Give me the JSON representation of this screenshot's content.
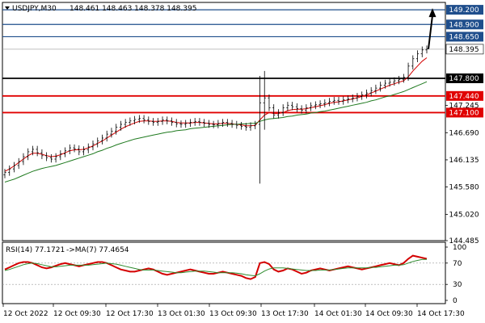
{
  "header": {
    "symbol_label": "USDJPY,M30",
    "ohlc_label": "148.461 148.463 148.378 148.395"
  },
  "rsi_header": {
    "rsi_label": "RSI(14) 77.1721",
    "ma_label": "->MA(7) 77.4654"
  },
  "colors": {
    "candle": "#000000",
    "ma_fast": "#d40000",
    "ma_slow": "#1f7a1f",
    "support": "#e00000",
    "resistance": "#1f4e8c",
    "pivot": "#000000",
    "rsi_line": "#d40000",
    "rsi_ma": "#2e8b2e",
    "arrow": "#000000"
  },
  "chart_data": [
    {
      "type": "candlestick",
      "title": "USDJPY,M30",
      "ylim": [
        144.485,
        149.35
      ],
      "y_ticks": [
        "149.200",
        "148.900",
        "148.650",
        "148.395",
        "147.800",
        "147.440",
        "147.245",
        "147.100",
        "146.690",
        "146.135",
        "145.580",
        "145.020",
        "144.485"
      ],
      "x_ticks": [
        "12 Oct 2022",
        "12 Oct 09:30",
        "12 Oct 17:30",
        "13 Oct 01:30",
        "13 Oct 09:30",
        "13 Oct 17:30",
        "14 Oct 01:30",
        "14 Oct 09:30",
        "14 Oct 17:30"
      ],
      "levels": [
        {
          "value": 149.2,
          "kind": "resistance"
        },
        {
          "value": 148.9,
          "kind": "resistance"
        },
        {
          "value": 148.65,
          "kind": "resistance"
        },
        {
          "value": 147.8,
          "kind": "pivot"
        },
        {
          "value": 147.44,
          "kind": "support"
        },
        {
          "value": 147.1,
          "kind": "support"
        }
      ],
      "current_price": 148.395,
      "arrow": {
        "from": 148.4,
        "to": 149.2
      },
      "series": [
        {
          "kind": "ohlc",
          "close": [
            145.88,
            145.95,
            146.02,
            146.1,
            146.2,
            146.3,
            146.35,
            146.28,
            146.22,
            146.18,
            146.15,
            146.2,
            146.26,
            146.32,
            146.38,
            146.36,
            146.3,
            146.34,
            146.4,
            146.46,
            146.52,
            146.58,
            146.66,
            146.72,
            146.8,
            146.86,
            146.9,
            146.93,
            146.96,
            146.98,
            146.95,
            146.92,
            146.9,
            146.92,
            146.95,
            146.93,
            146.9,
            146.87,
            146.86,
            146.88,
            146.9,
            146.92,
            146.9,
            146.88,
            146.86,
            146.85,
            146.88,
            146.9,
            146.88,
            146.86,
            146.84,
            146.82,
            146.8,
            146.83,
            146.86,
            147.3,
            147.4,
            147.2,
            147.05,
            147.1,
            147.2,
            147.25,
            147.22,
            147.18,
            147.15,
            147.2,
            147.24,
            147.26,
            147.28,
            147.3,
            147.33,
            147.35,
            147.33,
            147.36,
            147.38,
            147.4,
            147.43,
            147.46,
            147.5,
            147.55,
            147.6,
            147.66,
            147.7,
            147.72,
            147.75,
            147.78,
            147.82,
            148.05,
            148.2,
            148.3,
            148.38,
            148.4
          ]
        },
        {
          "name": "",
          "kind": "ma",
          "values": [
            145.9,
            145.95,
            146.01,
            146.08,
            146.15,
            146.22,
            146.27,
            146.27,
            146.25,
            146.22,
            146.2,
            146.21,
            146.24,
            146.28,
            146.32,
            146.34,
            146.34,
            146.35,
            146.38,
            146.42,
            146.47,
            146.52,
            146.58,
            146.64,
            146.7,
            146.76,
            146.81,
            146.85,
            146.89,
            146.92,
            146.93,
            146.93,
            146.92,
            146.92,
            146.93,
            146.93,
            146.92,
            146.9,
            146.89,
            146.89,
            146.89,
            146.9,
            146.9,
            146.89,
            146.88,
            146.87,
            146.87,
            146.88,
            146.88,
            146.87,
            146.86,
            146.85,
            146.83,
            146.83,
            146.84,
            146.95,
            147.05,
            147.1,
            147.08,
            147.08,
            147.1,
            147.14,
            147.16,
            147.17,
            147.17,
            147.18,
            147.2,
            147.22,
            147.24,
            147.26,
            147.29,
            147.31,
            147.32,
            147.34,
            147.36,
            147.38,
            147.4,
            147.43,
            147.46,
            147.5,
            147.54,
            147.58,
            147.62,
            147.66,
            147.69,
            147.72,
            147.75,
            147.83,
            147.95,
            148.05,
            148.15,
            148.22
          ]
        },
        {
          "name": "",
          "kind": "ma",
          "values": [
            145.68,
            145.71,
            145.74,
            145.78,
            145.82,
            145.86,
            145.9,
            145.93,
            145.96,
            145.98,
            146.0,
            146.02,
            146.05,
            146.08,
            146.11,
            146.14,
            146.17,
            146.2,
            146.23,
            146.26,
            146.3,
            146.33,
            146.37,
            146.4,
            146.44,
            146.47,
            146.5,
            146.53,
            146.56,
            146.58,
            146.6,
            146.62,
            146.64,
            146.66,
            146.68,
            146.7,
            146.71,
            146.73,
            146.74,
            146.75,
            146.77,
            146.78,
            146.79,
            146.8,
            146.81,
            146.82,
            146.83,
            146.84,
            146.85,
            146.86,
            146.86,
            146.87,
            146.87,
            146.88,
            146.88,
            146.92,
            146.95,
            146.97,
            146.98,
            146.99,
            147.0,
            147.02,
            147.03,
            147.05,
            147.06,
            147.07,
            147.09,
            147.1,
            147.12,
            147.13,
            147.15,
            147.17,
            147.19,
            147.21,
            147.23,
            147.25,
            147.27,
            147.29,
            147.31,
            147.34,
            147.36,
            147.39,
            147.42,
            147.44,
            147.47,
            147.5,
            147.53,
            147.57,
            147.61,
            147.65,
            147.69,
            147.73
          ]
        }
      ]
    },
    {
      "type": "line",
      "title": "RSI(14) 77.1721",
      "ylim": [
        0,
        100
      ],
      "y_ticks": [
        "100",
        "70",
        "30",
        "0"
      ],
      "series": [
        {
          "name": "RSI(14) 77.1721",
          "values": [
            58,
            62,
            66,
            70,
            72,
            72,
            70,
            66,
            62,
            60,
            62,
            65,
            68,
            70,
            68,
            66,
            64,
            66,
            68,
            70,
            72,
            72,
            70,
            66,
            62,
            58,
            56,
            54,
            54,
            56,
            58,
            60,
            58,
            54,
            50,
            48,
            50,
            52,
            54,
            56,
            58,
            56,
            54,
            52,
            50,
            50,
            52,
            54,
            52,
            50,
            48,
            46,
            42,
            40,
            44,
            70,
            72,
            68,
            58,
            54,
            56,
            60,
            58,
            54,
            50,
            52,
            56,
            58,
            60,
            58,
            56,
            58,
            60,
            62,
            64,
            62,
            60,
            58,
            60,
            62,
            64,
            66,
            68,
            70,
            68,
            66,
            70,
            78,
            84,
            82,
            80,
            78
          ]
        },
        {
          "name": "->MA(7) 77.4654",
          "values": [
            56,
            58,
            61,
            64,
            67,
            69,
            70,
            69,
            67,
            65,
            63,
            63,
            64,
            65,
            66,
            66,
            66,
            66,
            66,
            67,
            68,
            69,
            70,
            69,
            68,
            66,
            64,
            62,
            60,
            58,
            57,
            57,
            57,
            56,
            55,
            54,
            53,
            52,
            52,
            53,
            54,
            55,
            55,
            55,
            54,
            53,
            52,
            52,
            52,
            52,
            51,
            50,
            48,
            47,
            46,
            50,
            55,
            59,
            61,
            61,
            61,
            60,
            59,
            58,
            57,
            56,
            56,
            56,
            57,
            57,
            57,
            58,
            59,
            60,
            61,
            61,
            61,
            61,
            61,
            62,
            62,
            63,
            64,
            65,
            66,
            66,
            67,
            70,
            73,
            75,
            77,
            77
          ]
        }
      ]
    }
  ]
}
